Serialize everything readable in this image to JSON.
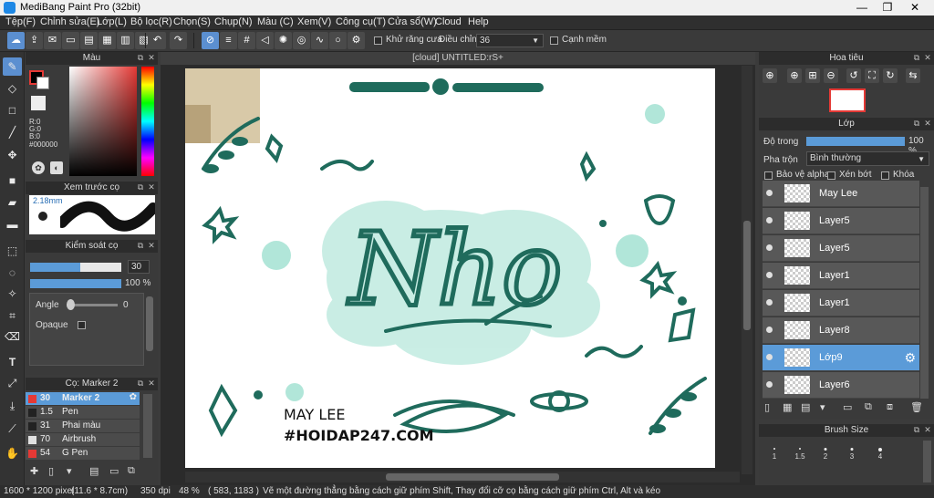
{
  "window": {
    "title": "MediBang Paint Pro (32bit)",
    "minimize": "—",
    "restore": "❐",
    "close": "✕"
  },
  "menu": [
    "Tệp(F)",
    "Chỉnh sửa(E)",
    "Lớp(L)",
    "Bộ lọc(R)",
    "Chọn(S)",
    "Chụp(N)",
    "Màu (C)",
    "Xem(V)",
    "Công cụ(T)",
    "Cửa sổ(W)",
    "Cloud",
    "Help"
  ],
  "toolbar": {
    "antialias_label": "Khử răng cưa",
    "correction_label": "Điều chỉnh",
    "correction_value": "36",
    "sharp_label": "Cạnh mềm"
  },
  "color_panel": {
    "title": "Màu",
    "r": "R:0",
    "g": "G:0",
    "b": "B:0",
    "hex": "#000000",
    "fg": "#000000",
    "bg": "#ffffff"
  },
  "preview_panel": {
    "title": "Xem trước cọ",
    "size": "2.18mm"
  },
  "brush_control": {
    "title": "Kiểm soát cọ",
    "size_value": "30",
    "size_fraction": 0.55,
    "opacity_value": "100 %",
    "opacity_fraction": 1.0,
    "angle_label": "Angle",
    "angle_value": "0",
    "opaque_label": "Opaque"
  },
  "brush_panel": {
    "title": "Cọ: Marker 2",
    "brushes": [
      {
        "size": "30",
        "name": "Marker 2",
        "color": "#e53935"
      },
      {
        "size": "1.5",
        "name": "Pen",
        "color": "#222222"
      },
      {
        "size": "31",
        "name": "Phai màu",
        "color": "#222222"
      },
      {
        "size": "70",
        "name": "Airbrush",
        "color": "#e0e0e0"
      },
      {
        "size": "54",
        "name": "G Pen",
        "color": "#e53935"
      }
    ]
  },
  "document": {
    "tab": "[cloud] UNTITLED:rS+"
  },
  "artwork": {
    "main_word": "Nho",
    "credit_name": "MAY LEE",
    "credit_site": "#HOIDAP247.COM",
    "accent": "#1f6b5c",
    "wash": "#9ee0cf"
  },
  "navigator": {
    "title": "Hoa tiêu"
  },
  "layer_panel": {
    "title": "Lớp",
    "opacity_label": "Độ trong",
    "opacity_value": "100 %",
    "opacity_fraction": 1.0,
    "blend_label": "Pha trộn",
    "blend_value": "Bình thường",
    "protect_alpha": "Bảo vệ alpha",
    "clipping": "Xén bớt",
    "lock": "Khóa",
    "layers": [
      "May Lee",
      "Layer5",
      "Layer5",
      "Layer1",
      "Layer1",
      "Layer8",
      "Lớp9",
      "Layer6"
    ],
    "selected_index": 6
  },
  "brush_size_panel": {
    "title": "Brush Size",
    "sizes": [
      "1",
      "1.5",
      "2",
      "3",
      "4"
    ]
  },
  "status": {
    "size": "1600 * 1200 pixel",
    "cm": "(11.6 * 8.7cm)",
    "dpi": "350 dpi",
    "zoom": "48 %",
    "coords": "( 583, 1183 )",
    "hint": "Vẽ một đường thẳng bằng cách giữ phím Shift, Thay đổi cỡ cọ bằng cách giữ phím Ctrl, Alt và kéo"
  }
}
